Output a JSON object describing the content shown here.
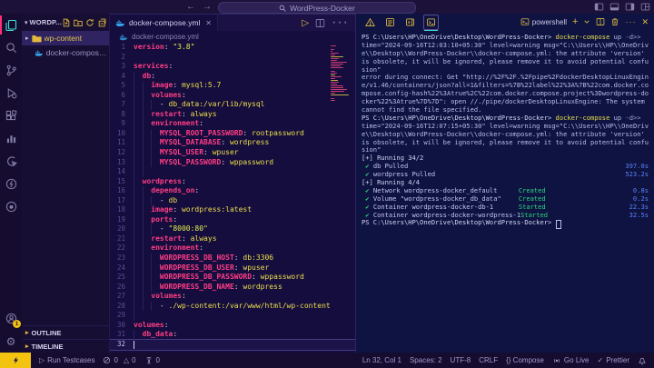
{
  "titlebar": {
    "search_value": "WordPress-Docker",
    "back_arrow": "←",
    "forward_arrow": "→"
  },
  "activity_bar": {
    "icons": [
      "explorer",
      "search",
      "source-control",
      "run-debug",
      "extensions",
      "chart",
      "live-share",
      "thunder-client",
      "github",
      "accounts",
      "settings"
    ],
    "accounts_badge": "1"
  },
  "explorer": {
    "title": "WORDP...",
    "action_icons": [
      "new-file",
      "new-folder",
      "refresh",
      "collapse-all"
    ],
    "items": [
      {
        "label": "wp-content",
        "type": "folder",
        "selected": true
      },
      {
        "label": "docker-compose.yml",
        "type": "docker-file",
        "selected": false
      }
    ],
    "sections": [
      "OUTLINE",
      "TIMELINE"
    ]
  },
  "editor": {
    "tab_label": "docker-compose.yml",
    "breadcrumb": "docker-compose.yml",
    "lines": [
      {
        "n": "1",
        "ind": 0,
        "seg": [
          [
            "k",
            "version"
          ],
          [
            "p",
            ": "
          ],
          [
            "s",
            "\"3.8\""
          ]
        ]
      },
      {
        "n": "2",
        "ind": 0,
        "seg": []
      },
      {
        "n": "3",
        "ind": 0,
        "seg": [
          [
            "k",
            "services"
          ],
          [
            "p",
            ":"
          ]
        ]
      },
      {
        "n": "4",
        "ind": 1,
        "seg": [
          [
            "k",
            "db"
          ],
          [
            "p",
            ":"
          ]
        ]
      },
      {
        "n": "5",
        "ind": 2,
        "seg": [
          [
            "k",
            "image"
          ],
          [
            "p",
            ": "
          ],
          [
            "v",
            "mysql:5.7"
          ]
        ]
      },
      {
        "n": "6",
        "ind": 2,
        "seg": [
          [
            "k",
            "volumes"
          ],
          [
            "p",
            ":"
          ]
        ]
      },
      {
        "n": "7",
        "ind": 3,
        "seg": [
          [
            "p",
            "- "
          ],
          [
            "v",
            "db_data:/var/lib/mysql"
          ]
        ]
      },
      {
        "n": "8",
        "ind": 2,
        "seg": [
          [
            "k",
            "restart"
          ],
          [
            "p",
            ": "
          ],
          [
            "v",
            "always"
          ]
        ]
      },
      {
        "n": "9",
        "ind": 2,
        "seg": [
          [
            "k",
            "environment"
          ],
          [
            "p",
            ":"
          ]
        ]
      },
      {
        "n": "10",
        "ind": 3,
        "seg": [
          [
            "k",
            "MYSQL_ROOT_PASSWORD"
          ],
          [
            "p",
            ": "
          ],
          [
            "v",
            "rootpassword"
          ]
        ]
      },
      {
        "n": "11",
        "ind": 3,
        "seg": [
          [
            "k",
            "MYSQL_DATABASE"
          ],
          [
            "p",
            ": "
          ],
          [
            "v",
            "wordpress"
          ]
        ]
      },
      {
        "n": "12",
        "ind": 3,
        "seg": [
          [
            "k",
            "MYSQL_USER"
          ],
          [
            "p",
            ": "
          ],
          [
            "v",
            "wpuser"
          ]
        ]
      },
      {
        "n": "13",
        "ind": 3,
        "seg": [
          [
            "k",
            "MYSQL_PASSWORD"
          ],
          [
            "p",
            ": "
          ],
          [
            "v",
            "wppassword"
          ]
        ]
      },
      {
        "n": "14",
        "ind": 2,
        "seg": []
      },
      {
        "n": "15",
        "ind": 1,
        "seg": [
          [
            "k",
            "wordpress"
          ],
          [
            "p",
            ":"
          ]
        ]
      },
      {
        "n": "16",
        "ind": 2,
        "seg": [
          [
            "k",
            "depends_on"
          ],
          [
            "p",
            ":"
          ]
        ]
      },
      {
        "n": "17",
        "ind": 3,
        "seg": [
          [
            "p",
            "- "
          ],
          [
            "v",
            "db"
          ]
        ]
      },
      {
        "n": "18",
        "ind": 2,
        "seg": [
          [
            "k",
            "image"
          ],
          [
            "p",
            ": "
          ],
          [
            "v",
            "wordpress:latest"
          ]
        ]
      },
      {
        "n": "19",
        "ind": 2,
        "seg": [
          [
            "k",
            "ports"
          ],
          [
            "p",
            ":"
          ]
        ]
      },
      {
        "n": "20",
        "ind": 3,
        "seg": [
          [
            "p",
            "- "
          ],
          [
            "s",
            "\"8000:80\""
          ]
        ]
      },
      {
        "n": "21",
        "ind": 2,
        "seg": [
          [
            "k",
            "restart"
          ],
          [
            "p",
            ": "
          ],
          [
            "v",
            "always"
          ]
        ]
      },
      {
        "n": "22",
        "ind": 2,
        "seg": [
          [
            "k",
            "environment"
          ],
          [
            "p",
            ":"
          ]
        ]
      },
      {
        "n": "23",
        "ind": 3,
        "seg": [
          [
            "k",
            "WORDPRESS_DB_HOST"
          ],
          [
            "p",
            ": "
          ],
          [
            "v",
            "db:3306"
          ]
        ]
      },
      {
        "n": "24",
        "ind": 3,
        "seg": [
          [
            "k",
            "WORDPRESS_DB_USER"
          ],
          [
            "p",
            ": "
          ],
          [
            "v",
            "wpuser"
          ]
        ]
      },
      {
        "n": "25",
        "ind": 3,
        "seg": [
          [
            "k",
            "WORDPRESS_DB_PASSWORD"
          ],
          [
            "p",
            ": "
          ],
          [
            "v",
            "wppassword"
          ]
        ]
      },
      {
        "n": "26",
        "ind": 3,
        "seg": [
          [
            "k",
            "WORDPRESS_DB_NAME"
          ],
          [
            "p",
            ": "
          ],
          [
            "v",
            "wordpress"
          ]
        ]
      },
      {
        "n": "27",
        "ind": 2,
        "seg": [
          [
            "k",
            "volumes"
          ],
          [
            "p",
            ":"
          ]
        ]
      },
      {
        "n": "28",
        "ind": 3,
        "seg": [
          [
            "p",
            "- "
          ],
          [
            "v",
            "./wp-content:/var/www/html/wp-content"
          ]
        ]
      },
      {
        "n": "29",
        "ind": 1,
        "seg": []
      },
      {
        "n": "30",
        "ind": 0,
        "seg": [
          [
            "k",
            "volumes"
          ],
          [
            "p",
            ":"
          ]
        ]
      },
      {
        "n": "31",
        "ind": 1,
        "seg": [
          [
            "k",
            "db_data"
          ],
          [
            "p",
            ":"
          ]
        ]
      },
      {
        "n": "32",
        "ind": 0,
        "seg": [],
        "cur": true
      }
    ]
  },
  "terminal": {
    "panel_tabs": [
      "problems",
      "output",
      "debug-console",
      "terminal"
    ],
    "shell_label": "powershell",
    "lines": [
      {
        "seg": [
          [
            "pr",
            "PS C:\\Users\\HP\\OneDrive\\Desktop\\WordPress-Docker> "
          ],
          [
            "cmd",
            "docker-compose"
          ],
          [
            "pl",
            " up "
          ],
          [
            "dim",
            "-d>>"
          ]
        ]
      },
      {
        "seg": [
          [
            "pl",
            "time=\"2024-09-16T12:03:10+05:30\" level=warning msg=\"C:\\\\Users\\\\HP\\\\OneDriv"
          ]
        ]
      },
      {
        "seg": [
          [
            "pl",
            "e\\\\Desktop\\\\WordPress-Docker\\\\docker-compose.yml: the attribute 'version'"
          ]
        ]
      },
      {
        "seg": [
          [
            "pl",
            "is obsolete, it will be ignored, please remove it to avoid potential confu"
          ]
        ]
      },
      {
        "seg": [
          [
            "pl",
            "sion\""
          ]
        ]
      },
      {
        "seg": [
          [
            "pl",
            "error during connect: Get \"http://%2F%2F.%2Fpipe%2FdockerDesktopLinuxEngin"
          ]
        ]
      },
      {
        "seg": [
          [
            "pl",
            "e/v1.46/containers/json?all=1&filters=%7B%22label%22%3A%7B%22com.docker.co"
          ]
        ]
      },
      {
        "seg": [
          [
            "pl",
            "mpose.config-hash%22%3Atrue%2C%22com.docker.compose.project%3Dwordpress-do"
          ]
        ]
      },
      {
        "seg": [
          [
            "pl",
            "cker%22%3Atrue%7D%7D\": open //./pipe/dockerDesktopLinuxEngine: The system"
          ]
        ]
      },
      {
        "seg": [
          [
            "pl",
            "cannot find the file specified."
          ]
        ]
      },
      {
        "seg": [
          [
            "pr",
            "PS C:\\Users\\HP\\OneDrive\\Desktop\\WordPress-Docker> "
          ],
          [
            "cmd",
            "docker-compose"
          ],
          [
            "pl",
            " up "
          ],
          [
            "dim",
            "-d>>"
          ]
        ]
      },
      {
        "seg": [
          [
            "pl",
            "time=\"2024-09-16T12:07:15+05:30\" level=warning msg=\"C:\\\\Users\\\\HP\\\\OneDriv"
          ]
        ]
      },
      {
        "seg": [
          [
            "pl",
            "e\\\\Desktop\\\\WordPress-Docker\\\\docker-compose.yml: the attribute 'version'"
          ]
        ]
      },
      {
        "seg": [
          [
            "pl",
            "is obsolete, it will be ignored, please remove it to avoid potential confu"
          ]
        ]
      },
      {
        "seg": [
          [
            "pl",
            "sion\""
          ]
        ]
      },
      {
        "seg": [
          [
            "pr",
            "[+] Running 34/2"
          ]
        ]
      },
      {
        "task": {
          "check": " ✔ ",
          "text": "db Pulled",
          "status": "",
          "time": "397.0s",
          "wide": false
        }
      },
      {
        "task": {
          "check": " ✔ ",
          "text": "wordpress Pulled",
          "status": "",
          "time": "523.2s",
          "wide": false
        }
      },
      {
        "seg": [
          [
            "pr",
            "[+] Running 4/4"
          ]
        ]
      },
      {
        "task": {
          "check": " ✔ ",
          "text": "Network wordpress-docker_default",
          "status": "Created",
          "time": "0.8s",
          "wide": true
        }
      },
      {
        "task": {
          "check": " ✔ ",
          "text": "Volume \"wordpress-docker_db_data\"",
          "status": "Created",
          "time": "0.2s",
          "wide": true
        }
      },
      {
        "task": {
          "check": " ✔ ",
          "text": "Container wordpress-docker-db-1",
          "status": "Started",
          "time": "22.3s",
          "wide": true
        }
      },
      {
        "task": {
          "check": " ✔ ",
          "text": "Container wordpress-docker-wordpress-1",
          "status": "Started",
          "time": "32.5s",
          "wide": true
        }
      },
      {
        "seg": [
          [
            "pr",
            "PS C:\\Users\\HP\\OneDrive\\Desktop\\WordPress-Docker> "
          ],
          [
            "cursor",
            ""
          ]
        ]
      }
    ]
  },
  "statusbar": {
    "run_tests": "Run Testcases",
    "errors": "0",
    "warnings": "0",
    "ports": "0",
    "line_col": "Ln 32, Col 1",
    "spaces": "Spaces: 2",
    "encoding": "UTF-8",
    "eol": "CRLF",
    "language": "{} Compose",
    "go_live": "Go Live",
    "formatter": "Prettier"
  },
  "colors": {
    "accent_pink": "#ff2e79",
    "accent_cyan": "#3fe0d0",
    "accent_yellow": "#f2c40f",
    "key_pink": "#ff3d85",
    "value_yellow": "#efdf4e",
    "success_green": "#2fd57d",
    "duration_blue": "#5b82f5",
    "docker_blue": "#35a3e8"
  }
}
